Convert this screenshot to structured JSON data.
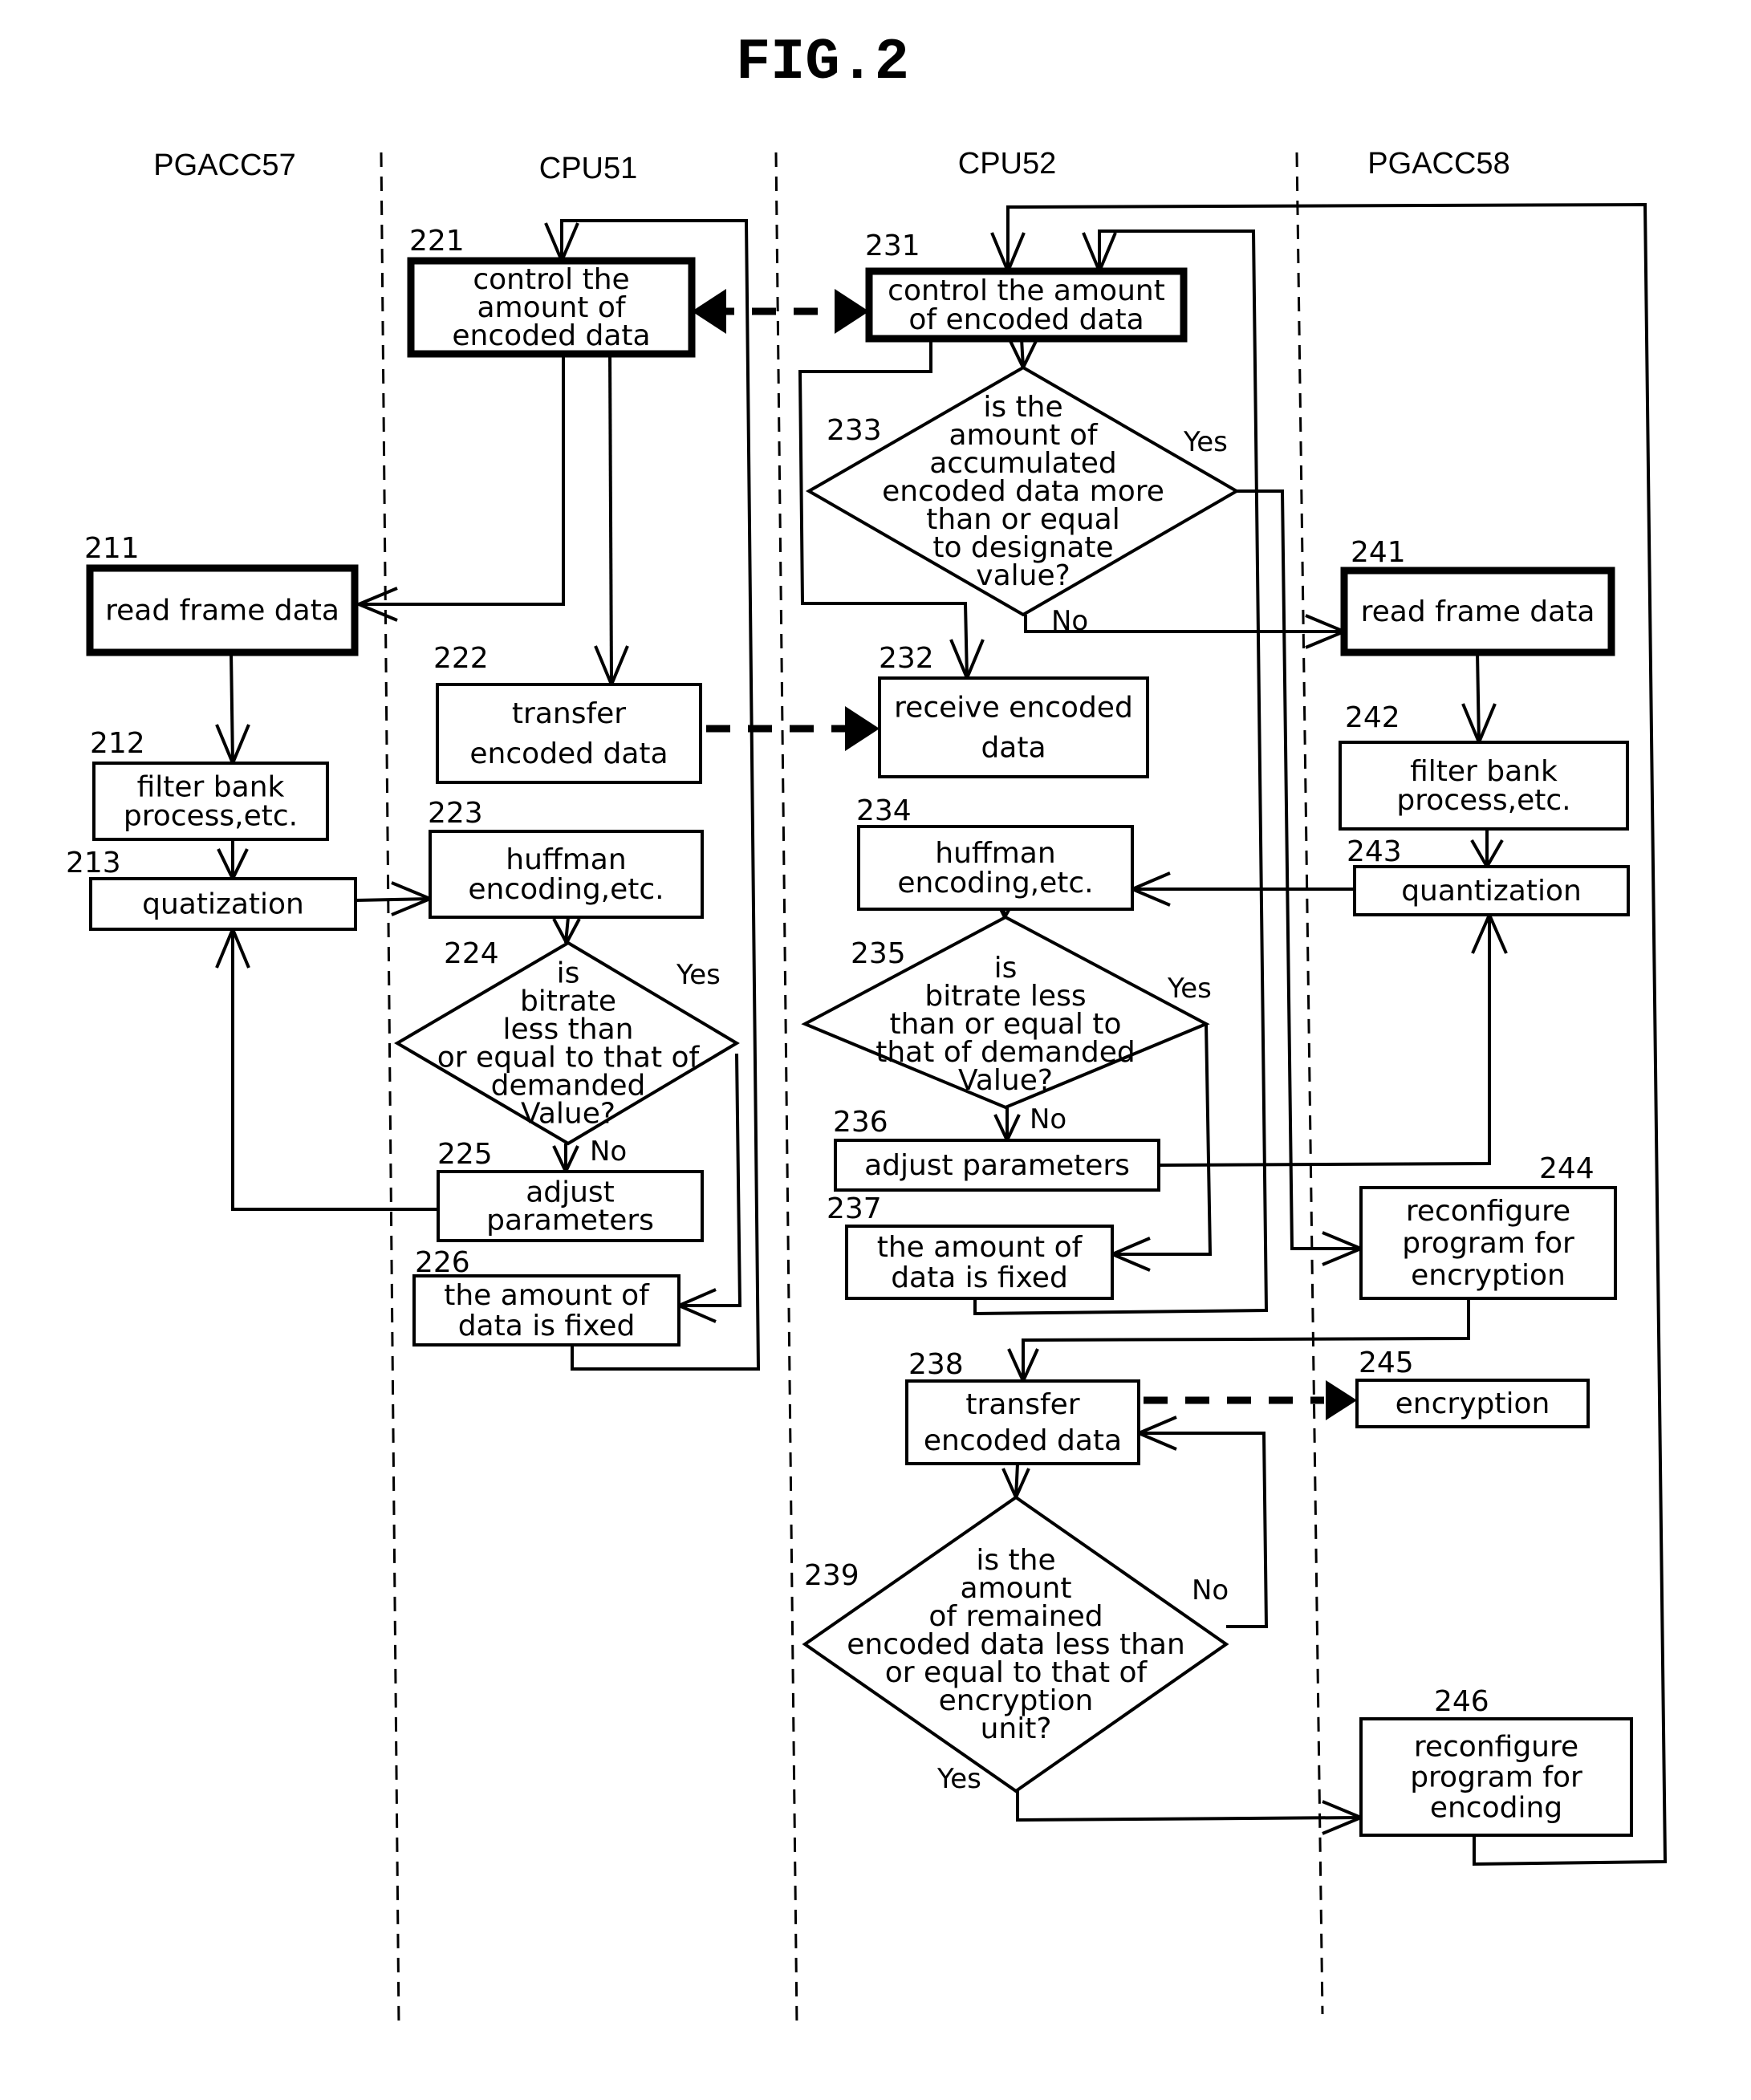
{
  "figure": {
    "title": "FIG.2"
  },
  "lanes": [
    {
      "label": "PGACC57"
    },
    {
      "label": "CPU51"
    },
    {
      "label": "CPU52"
    },
    {
      "label": "PGACC58"
    }
  ],
  "steps": {
    "s211": {
      "ref": "211",
      "lines": [
        "read frame data"
      ]
    },
    "s212": {
      "ref": "212",
      "lines": [
        "filter bank",
        "process,etc."
      ]
    },
    "s213": {
      "ref": "213",
      "lines": [
        "quatization"
      ]
    },
    "s221": {
      "ref": "221",
      "lines": [
        "control the",
        "amount of",
        "encoded data"
      ]
    },
    "s222": {
      "ref": "222",
      "lines": [
        "transfer",
        "encoded data"
      ]
    },
    "s223": {
      "ref": "223",
      "lines": [
        "huffman",
        "encoding,etc."
      ]
    },
    "s224": {
      "ref": "224",
      "lines": [
        "is",
        "bitrate",
        "less than",
        "or equal to that of",
        "demanded",
        "Value?"
      ]
    },
    "s225": {
      "ref": "225",
      "lines": [
        "adjust",
        "parameters"
      ]
    },
    "s226": {
      "ref": "226",
      "lines": [
        "the amount of",
        "data is fixed"
      ]
    },
    "s231": {
      "ref": "231",
      "lines": [
        "control the amount",
        "of encoded data"
      ]
    },
    "s232": {
      "ref": "232",
      "lines": [
        "receive encoded",
        "data"
      ]
    },
    "s233": {
      "ref": "233",
      "lines": [
        "is the",
        "amount of",
        "accumulated",
        "encoded data more",
        "than or equal",
        "to designate",
        "value?"
      ]
    },
    "s234": {
      "ref": "234",
      "lines": [
        "huffman",
        "encoding,etc."
      ]
    },
    "s235": {
      "ref": "235",
      "lines": [
        "is",
        "bitrate less",
        "than or equal to",
        "that of demanded",
        "Value?"
      ]
    },
    "s236": {
      "ref": "236",
      "lines": [
        "adjust parameters"
      ]
    },
    "s237": {
      "ref": "237",
      "lines": [
        "the amount of",
        "data is fixed"
      ]
    },
    "s238": {
      "ref": "238",
      "lines": [
        "transfer",
        "encoded data"
      ]
    },
    "s239": {
      "ref": "239",
      "lines": [
        "is the",
        "amount",
        "of remained",
        "encoded data less than",
        "or equal to that of",
        "encryption",
        "unit?"
      ]
    },
    "s241": {
      "ref": "241",
      "lines": [
        "read frame data"
      ]
    },
    "s242": {
      "ref": "242",
      "lines": [
        "filter bank",
        "process,etc."
      ]
    },
    "s243": {
      "ref": "243",
      "lines": [
        "quantization"
      ]
    },
    "s244": {
      "ref": "244",
      "lines": [
        "reconfigure",
        "program for",
        "encryption"
      ]
    },
    "s245": {
      "ref": "245",
      "lines": [
        "encryption"
      ]
    },
    "s246": {
      "ref": "246",
      "lines": [
        "reconfigure",
        "program for",
        "encoding"
      ]
    }
  },
  "branch_labels": {
    "yes": "Yes",
    "no": "No"
  }
}
